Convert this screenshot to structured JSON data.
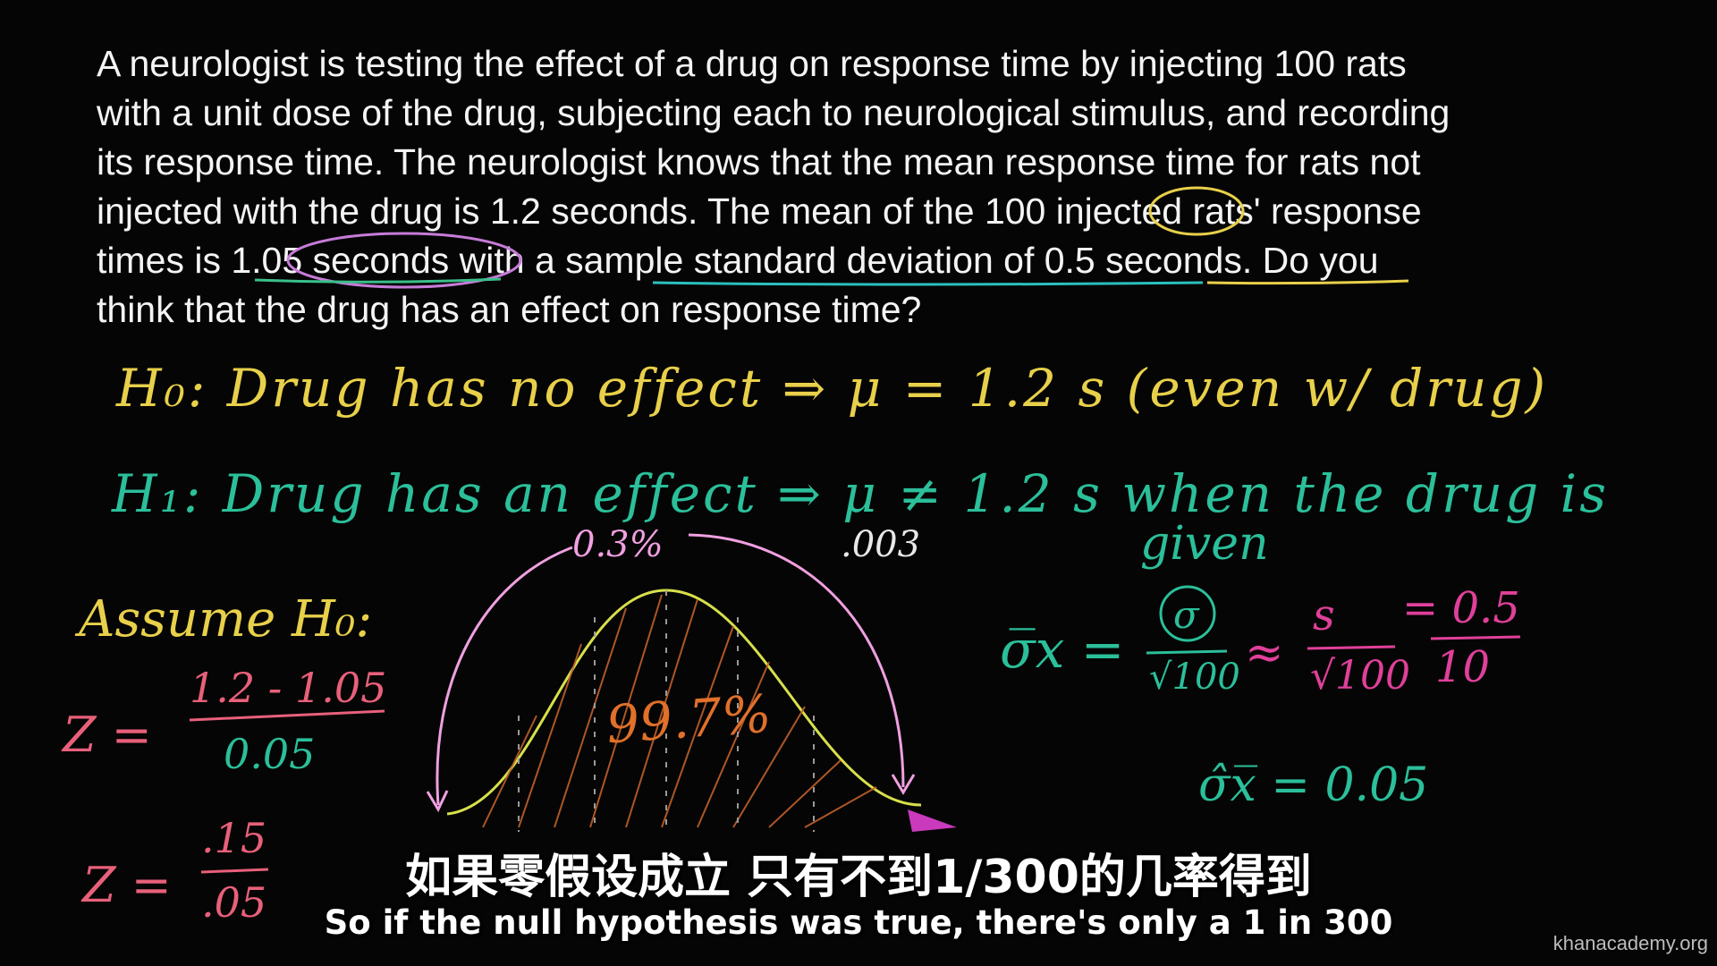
{
  "problem": {
    "lines": [
      "A neurologist is testing the effect of a drug on response time by injecting 100 rats",
      "with a unit dose of the drug, subjecting each to neurological stimulus, and recording",
      "its response time.  The neurologist knows that the mean response time for rats not",
      "injected with the drug is 1.2 seconds.  The mean of the 100 injected rats' response",
      "times is 1.05 seconds with a sample standard deviation of 0.5 seconds.  Do you",
      "think that the drug has an effect on response time?"
    ]
  },
  "handwriting": {
    "h0": "H₀: Drug has no effect ⇒  μ = 1.2 s   (even w/ drug)",
    "h1": "H₁: Drug has an effect ⇒  μ ≠ 1.2 s  when the drug is",
    "given": "given",
    "assume": "Assume H₀:",
    "z_numerator": "1.2 - 1.05",
    "z_label": "Z =",
    "z_denominator": "0.05",
    "z2_label": "Z =",
    "z2_numerator": ".15",
    "z2_denominator": ".05",
    "pct_tail": "0.3%",
    "pct_tail_decimal": ".003",
    "pct_middle": "99.7%",
    "sigma_xbar": "σ̅x =",
    "sqrt100_a": "√100",
    "approx": "≈",
    "s_over": "s",
    "sqrt100_b": "√100",
    "eq_05": "= 0.5",
    "ten": "10",
    "sigma_hat": "σ̂x̅ = 0.05"
  },
  "subtitles": {
    "chinese": "如果零假设成立 只有不到1/300的几率得到",
    "english": "So if the null hypothesis was true, there's only a 1 in 300"
  },
  "watermark": "khanacademy.org",
  "colors": {
    "background": "#050505",
    "yellow": "#e8d04a",
    "green": "#2bbf9a",
    "pink": "#e8607a",
    "magenta": "#e0409a",
    "orange": "#e0702a"
  }
}
